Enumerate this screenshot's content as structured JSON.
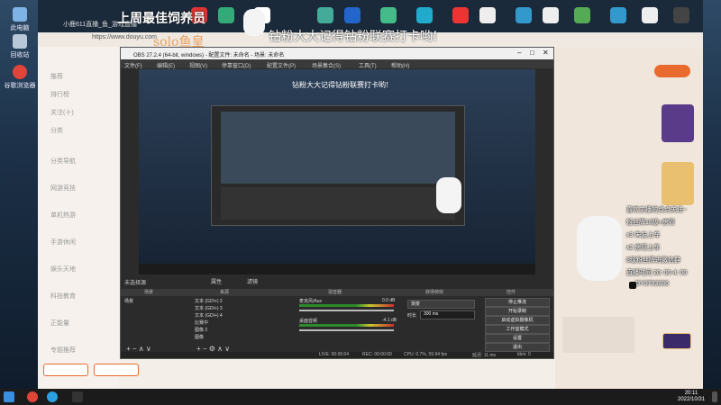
{
  "desktop": {
    "icons": [
      {
        "label": "此电脑",
        "color": "#7fb3e6"
      },
      {
        "label": "回收站",
        "color": "#b8c8d8"
      },
      {
        "label": "谷歌浏览器",
        "color": "#e0453a"
      }
    ]
  },
  "browser": {
    "tab_title": "小鹿611直播_鱼_游戏直播",
    "url": "https://www.douyu.com",
    "sidebar_items": [
      "推荐",
      "排行榜",
      "关注(十)",
      "分类",
      "分类导航",
      "网游竞技",
      "单机热游",
      "手游休闲",
      "娱乐天地",
      "科技教育",
      "正能量",
      "专题推荐"
    ]
  },
  "overlay": {
    "banner_left": "上周最佳饲养员",
    "banner_right": "钻粉大大记得钻粉联赛打卡哟!",
    "solo": "solo鱼皇"
  },
  "obs": {
    "title": "OBS 27.2.4 (64-bit, windows) - 配置文件: 未命名 - 场景: 未命名",
    "menu": [
      "文件(F)",
      "编辑(E)",
      "视图(V)",
      "停靠窗口(D)",
      "配置文件(P)",
      "场景集合(S)",
      "工具(T)",
      "帮助(H)"
    ],
    "preview_title": "钻粉大大记得钻粉联赛打卡哟!",
    "no_source": "未选择源",
    "props": "属性",
    "filters": "滤镜",
    "docks": {
      "scenes": "场景",
      "sources": "来源",
      "mixer": "混音器",
      "transitions": "转场特效",
      "controls": "控件"
    },
    "scene_item": "场景",
    "sources": [
      "文本 (GDI+) 2",
      "文本 (GDI+) 3",
      "文本 (GDI+) 4",
      "比赛中",
      "图像 2",
      "图像"
    ],
    "mixer": [
      {
        "name": "麦克风/Aux",
        "db": "0.0 dB"
      },
      {
        "name": "桌面音频",
        "db": "-4.1 dB"
      }
    ],
    "transition": "渐变",
    "duration_label": "时长",
    "duration": "300 ms",
    "controls": [
      "停止推流",
      "开始录制",
      "启动虚拟摄像机",
      "工作室模式",
      "设置",
      "退出"
    ],
    "status": {
      "live": "LIVE: 00:00:04",
      "rec": "REC: 00:00:00",
      "cpu": "CPU: 0.7%, 59.94 fps",
      "dropped": "延迟: 11 ms",
      "kbps": "kb/s: 0"
    }
  },
  "stream_overlay": {
    "header": "喜欢主播的点点关注~",
    "lines": [
      "粉丝牌18级+房管",
      "x3 朱友上车",
      "x2 房管上车",
      "8级粉丝牌进微信群",
      "直播时间 20: 00-4: 00",
      "DY9793886"
    ]
  },
  "taskbar": {
    "time": "20:11",
    "date": "2022/10/31"
  },
  "colors": {
    "accent": "#e86a2c",
    "obs_bg": "#2b2b2b",
    "live_red": "#d8493c"
  }
}
